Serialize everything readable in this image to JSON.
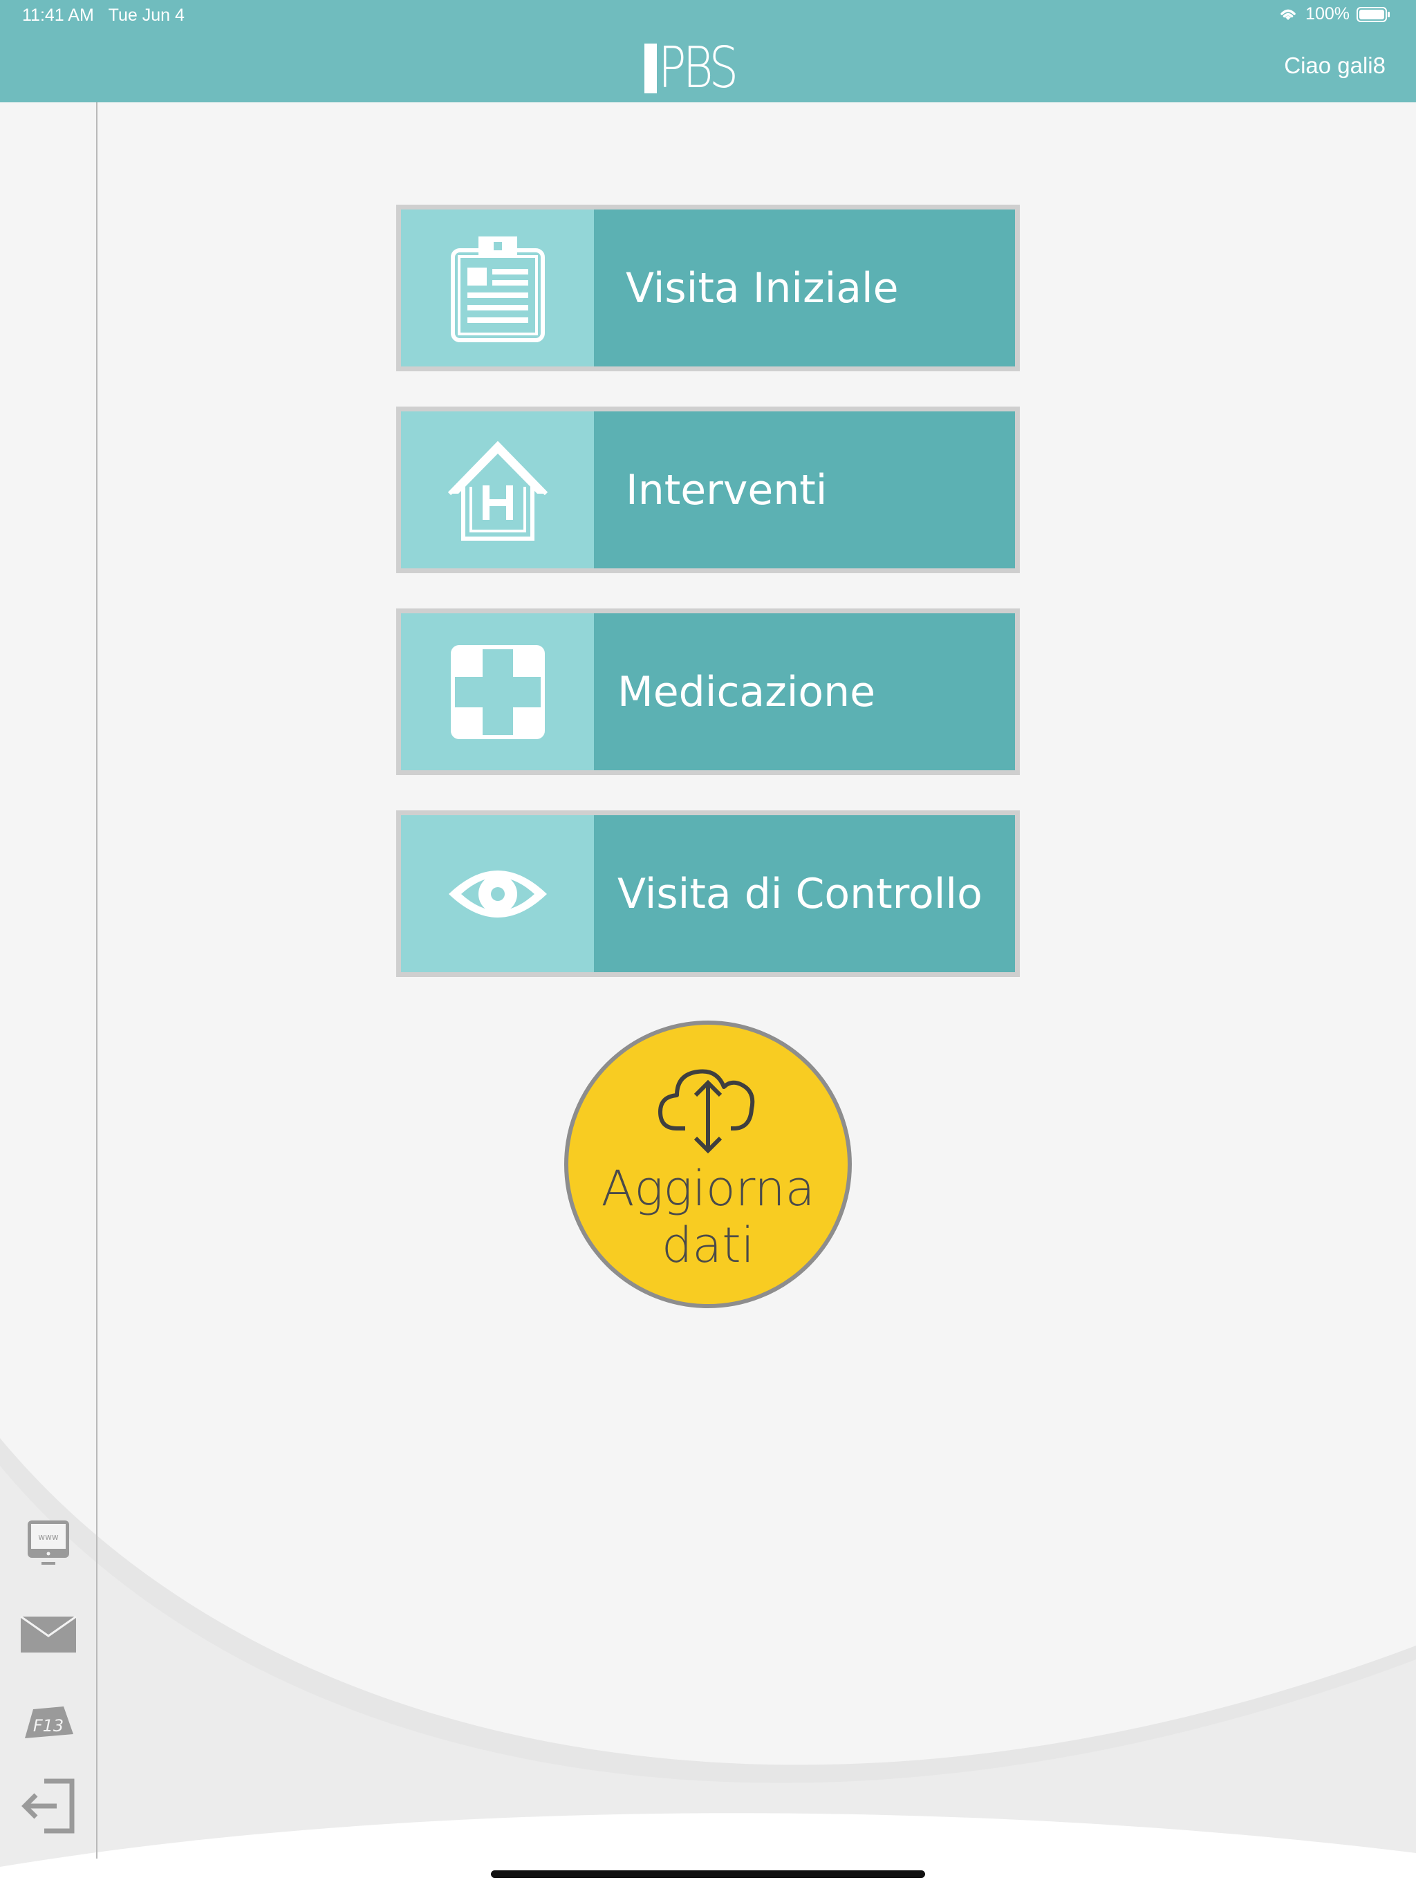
{
  "status_bar": {
    "time": "11:41 AM",
    "date": "Tue Jun 4",
    "battery": "100%"
  },
  "header": {
    "logo": "PBS",
    "greeting": "Ciao gali8"
  },
  "menu": [
    {
      "label": "Visita Iniziale",
      "icon": "clipboard-icon"
    },
    {
      "label": "Interventi",
      "icon": "hospital-icon"
    },
    {
      "label": "Medicazione",
      "icon": "medical-cross-icon"
    },
    {
      "label": "Visita di Controllo",
      "icon": "eye-icon"
    }
  ],
  "update_button": {
    "line1": "Aggiorna",
    "line2": "dati",
    "icon": "cloud-sync-icon"
  },
  "sidebar": {
    "icons": [
      "web-monitor-icon",
      "mail-icon",
      "f13-tag-icon",
      "logout-icon"
    ],
    "tag_text": "F13",
    "web_text": "www"
  },
  "colors": {
    "header": "#70bcbe",
    "tile_light": "#93d6d7",
    "tile_dark": "#5cb1b3",
    "update_yellow": "#f8cc22"
  }
}
